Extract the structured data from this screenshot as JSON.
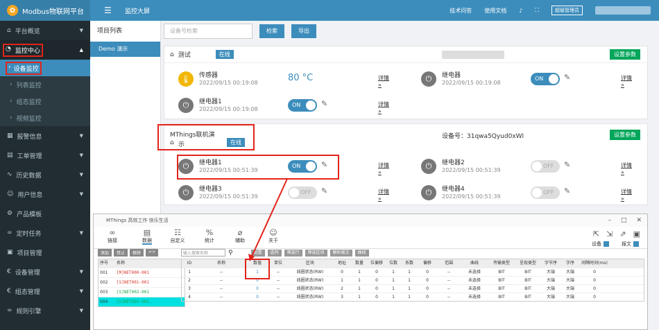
{
  "topbar": {
    "app_title": "Modbus物联网平台",
    "page_title": "监控大屏",
    "links": [
      "技术问答",
      "使用文档"
    ],
    "admin": "超级管理员"
  },
  "sidebar": {
    "items": [
      {
        "label": "平台概览",
        "icon": "home-icon"
      },
      {
        "label": "监控中心",
        "icon": "dashboard-icon"
      },
      {
        "label": "报警信息",
        "icon": "alarm-icon"
      },
      {
        "label": "工单管理",
        "icon": "ticket-icon"
      },
      {
        "label": "历史数据",
        "icon": "chart-icon"
      },
      {
        "label": "用户信息",
        "icon": "user-icon"
      },
      {
        "label": "产品模板",
        "icon": "template-icon"
      },
      {
        "label": "定时任务",
        "icon": "timer-icon"
      },
      {
        "label": "项目管理",
        "icon": "project-icon"
      },
      {
        "label": "设备管理",
        "icon": "device-icon"
      },
      {
        "label": "组态管理",
        "icon": "config-icon"
      },
      {
        "label": "规则引擎",
        "icon": "rule-icon"
      }
    ],
    "sub": [
      "设备监控",
      "列表监控",
      "组态监控",
      "视频监控"
    ]
  },
  "project": {
    "heading": "项目列表",
    "item": "Demo 演示"
  },
  "search": {
    "placeholder": "设备号检索",
    "btn_search": "检索",
    "btn_export": "导出"
  },
  "devices": [
    {
      "name": "测试",
      "status": "在线",
      "param_btn": "设置参数",
      "cards": [
        {
          "name": "传感器",
          "time": "2022/09/15 00:19:08",
          "value": "80 °C",
          "detail": "详情 »"
        },
        {
          "name": "继电器",
          "time": "2022/09/15 00:19:08",
          "toggle": "ON",
          "detail": "详情 »"
        },
        {
          "name": "继电器1",
          "time": "2022/09/15 00:19:08",
          "toggle": "ON",
          "detail": "详情 »"
        }
      ]
    },
    {
      "name_line1": "MThings联机演",
      "name_line2": "示",
      "status": "在线",
      "devno": "设备号：31qwa5Qyud0xWI",
      "param_btn": "设置参数",
      "cards": [
        {
          "name": "继电器1",
          "time": "2022/09/15 00:51:39",
          "toggle": "ON",
          "detail": "详情 »"
        },
        {
          "name": "继电器2",
          "time": "2022/09/15 00:51:39",
          "toggle": "OFF",
          "detail": "详情 »"
        },
        {
          "name": "继电器3",
          "time": "2022/09/15 00:51:39",
          "toggle": "OFF",
          "detail": "详情 »"
        },
        {
          "name": "继电器4",
          "time": "2022/09/15 00:51:39",
          "toggle": "OFF",
          "detail": "详情 »"
        }
      ]
    }
  ],
  "win": {
    "title": "MThings 高效工作 快乐生活",
    "tools": [
      "链接",
      "数据",
      "自定义",
      "统计",
      "辅助",
      "关于"
    ],
    "right_labels": [
      "设备",
      "报文"
    ],
    "left_buttons": [
      "添加",
      "禁止",
      "移除",
      ">>"
    ],
    "left_head": [
      "序号",
      "名称"
    ],
    "left_rows": [
      {
        "no": "001",
        "name": "[M]NET000-001",
        "color": "red"
      },
      {
        "no": "002",
        "name": "[S]NET001-001",
        "color": "red"
      },
      {
        "no": "003",
        "name": "[S]NET002-001",
        "color": "grn"
      },
      {
        "no": "004",
        "name": "[S]NET003-001",
        "color": "grn"
      }
    ],
    "filter_placeholder": "输入搜索名称",
    "grid_buttons": [
      "配置",
      "选列",
      "筛选行",
      "筛选区块",
      "解析报文",
      "曲线"
    ],
    "grid_head": [
      "ID",
      "名称",
      "数值",
      "单位",
      "区块",
      "地址",
      "数量",
      "位偏移",
      "位数",
      "系数",
      "偏移",
      "范围",
      "曲线",
      "传输类型",
      "呈现类型",
      "字节序",
      "字序",
      "间隔时间(ms)"
    ],
    "grid_rows": [
      [
        "1",
        "--",
        "1",
        "--",
        "线圈状态(RW)",
        "0",
        "1",
        "0",
        "1",
        "1",
        "0",
        "--",
        "未选择",
        "BIT",
        "BIT",
        "大端",
        "大端",
        "0"
      ],
      [
        "2",
        "--",
        "0",
        "--",
        "线圈状态(RW)",
        "1",
        "1",
        "0",
        "1",
        "1",
        "0",
        "--",
        "未选择",
        "BIT",
        "BIT",
        "大端",
        "大端",
        "0"
      ],
      [
        "3",
        "--",
        "0",
        "--",
        "线圈状态(RW)",
        "2",
        "1",
        "0",
        "1",
        "1",
        "0",
        "--",
        "未选择",
        "BIT",
        "BIT",
        "大端",
        "大端",
        "0"
      ],
      [
        "4",
        "--",
        "0",
        "--",
        "线圈状态(RW)",
        "3",
        "1",
        "0",
        "1",
        "1",
        "0",
        "--",
        "未选择",
        "BIT",
        "BIT",
        "大端",
        "大端",
        "0"
      ]
    ]
  }
}
